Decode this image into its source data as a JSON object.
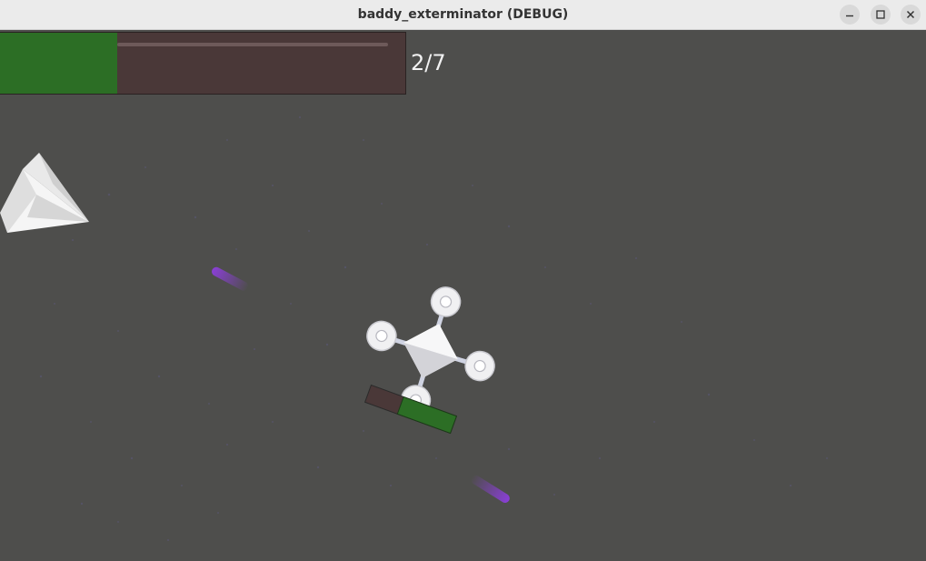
{
  "window": {
    "title": "baddy_exterminator (DEBUG)",
    "controls": {
      "minimize": "minimize-icon",
      "maximize": "maximize-icon",
      "close": "close-icon"
    }
  },
  "hud": {
    "progress_fraction": 0.29,
    "counter_text": "2/7",
    "fill_color": "#2c6e25",
    "empty_color": "#4a3838"
  },
  "player": {
    "kind": "quadcopter-drone",
    "health_fraction": 0.62,
    "health_fill_color": "#2c6e25",
    "health_empty_color": "#4a3838"
  },
  "enemies": [
    {
      "kind": "paper-plane"
    }
  ],
  "projectiles": [
    {
      "kind": "plasma-bolt",
      "color": "#8a3fd6"
    },
    {
      "kind": "plasma-bolt",
      "color": "#8a3fd6"
    }
  ],
  "colors": {
    "background": "#4e4e4c",
    "titlebar": "#ebebeb"
  }
}
